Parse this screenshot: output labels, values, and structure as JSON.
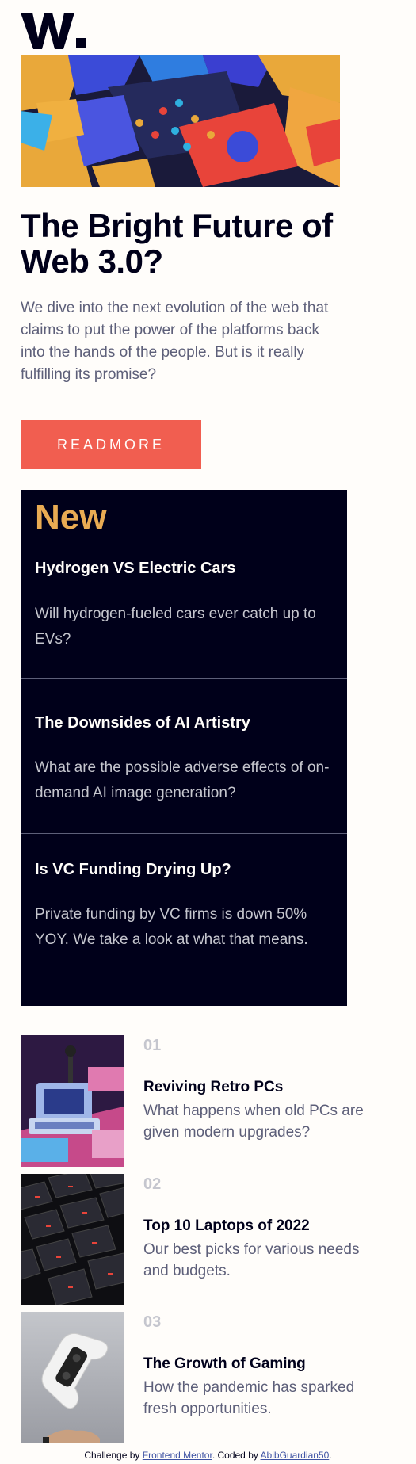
{
  "brand": {
    "logo_letter": "W."
  },
  "hero": {
    "title": "The Bright Future of Web 3.0?",
    "description": "We dive into the next evolution of the web that claims to put the power of the platforms back into the hands of the people. But is it really fulfilling its promise?",
    "read_more_label": "READMORE"
  },
  "new_section": {
    "heading": "New",
    "items": [
      {
        "title": "Hydrogen VS Electric Cars",
        "text": "Will hydrogen-fueled cars ever catch up to EVs?"
      },
      {
        "title": "The Downsides of AI Artistry",
        "text": "What are the possible adverse effects of on-demand AI image generation?"
      },
      {
        "title": "Is VC Funding Drying Up?",
        "text": "Private funding by VC firms is down 50% YOY. We take a look at what that means."
      }
    ]
  },
  "ranked_articles": [
    {
      "number": "01",
      "title": "Reviving Retro PCs",
      "text": "What happens when old PCs are given modern upgrades?",
      "image_icon": "retro-pc-image"
    },
    {
      "number": "02",
      "title": "Top 10 Laptops of 2022",
      "text": "Our best picks for various needs and budgets.",
      "image_icon": "laptop-keyboard-image"
    },
    {
      "number": "03",
      "title": "The Growth of Gaming",
      "text": "How the pandemic has sparked fresh opportunities.",
      "image_icon": "game-controller-image"
    }
  ],
  "attribution": {
    "prefix": "Challenge by",
    "challenge_link": "Frontend Mentor",
    "middle": ". Coded by",
    "author_link": "AbibGuardian50",
    "suffix": "."
  },
  "colors": {
    "accent_red": "#f15e50",
    "accent_orange": "#e9ab53",
    "dark_navy": "#00001a",
    "grayish_blue": "#5d5f79",
    "off_white": "#fffdfa"
  }
}
